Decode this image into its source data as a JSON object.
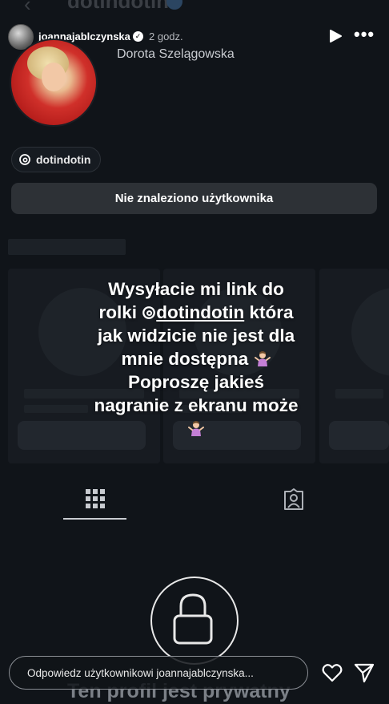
{
  "background_profile": {
    "username_header": "dotindotin",
    "display_name": "Dorota Szelągowska",
    "threads_handle": "dotindotin",
    "not_found_message": "Nie znaleziono użytkownika",
    "private_message": "Ten profil jest prywatny"
  },
  "story": {
    "author": "joannajablczynska",
    "time": "2 godz.",
    "text_lines": [
      "Wysyłacie mi link do",
      "rolki ",
      "@dotindotin",
      " która",
      "jak widzicie nie jest dla",
      "mnie dostępna ",
      "Poproszę jakieś",
      "nagranie z ekranu może"
    ]
  },
  "reply": {
    "placeholder": "Odpowiedz użytkownikowi joannajablczynska..."
  },
  "icons": {
    "back": "back-arrow-icon",
    "verified": "verified-badge-icon",
    "play": "play-icon",
    "more": "more-options-icon",
    "threads": "threads-icon",
    "grid": "posts-grid-icon",
    "tagged": "tagged-person-icon",
    "lock": "lock-icon",
    "heart": "heart-icon",
    "send": "send-icon",
    "emoji": "person-shrugging-emoji"
  },
  "colors": {
    "background": "#101419",
    "button_bg": "#2d3136",
    "verified": "#3897f0"
  }
}
